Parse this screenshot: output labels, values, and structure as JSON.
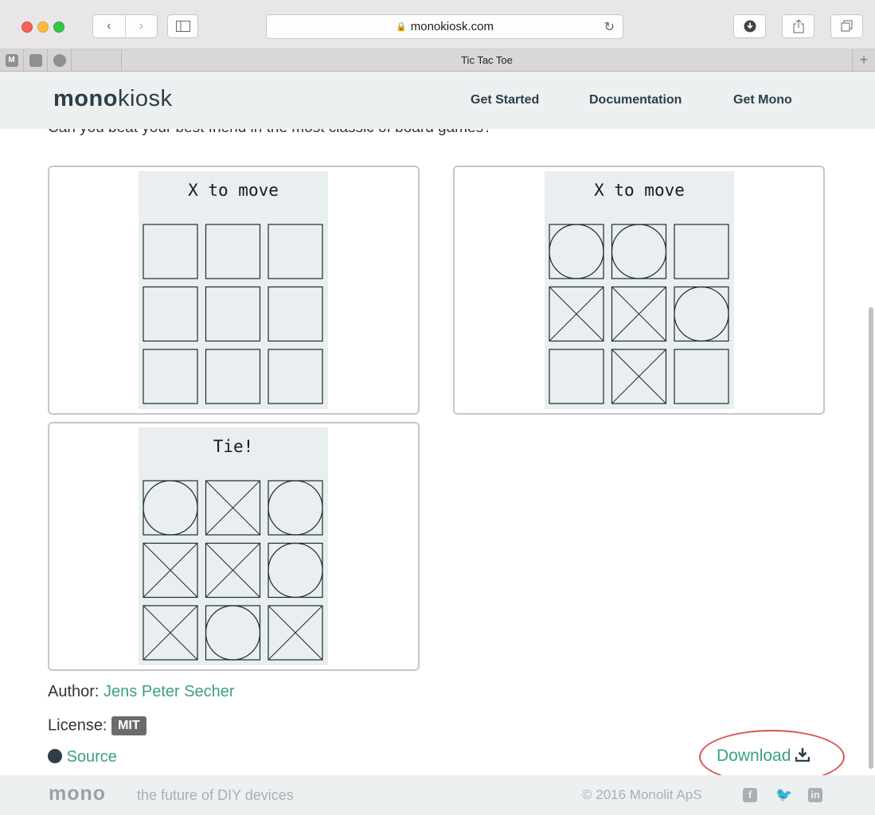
{
  "browser": {
    "url": "monokiosk.com",
    "tab_title": "Tic Tac Toe",
    "pinned_tabs": [
      "M",
      "",
      ""
    ]
  },
  "site": {
    "logo_bold": "mono",
    "logo_light": "kiosk",
    "nav": [
      "Get Started",
      "Documentation",
      "Get Mono"
    ]
  },
  "intro": "Can you beat your best friend in the most classic of board games?",
  "screens": [
    {
      "title": "X to move",
      "board": [
        "",
        "",
        "",
        "",
        "",
        "",
        "",
        "",
        ""
      ]
    },
    {
      "title": "X to move",
      "board": [
        "O",
        "O",
        "",
        "X",
        "X",
        "O",
        "",
        "X",
        ""
      ]
    },
    {
      "title": "Tie!",
      "board": [
        "O",
        "X",
        "O",
        "X",
        "X",
        "O",
        "X",
        "O",
        "X"
      ]
    }
  ],
  "meta": {
    "author_label": "Author:",
    "author": "Jens Peter Secher",
    "license_label": "License:",
    "license": "MIT",
    "source": "Source",
    "download": "Download"
  },
  "footer": {
    "logo": "mono",
    "tagline": "the future of DIY devices",
    "copyright": "2016 Monolit ApS"
  },
  "colors": {
    "accent": "#3aa27a",
    "highlight_ring": "#d9534f",
    "nav_bg": "#ecf0f1"
  }
}
